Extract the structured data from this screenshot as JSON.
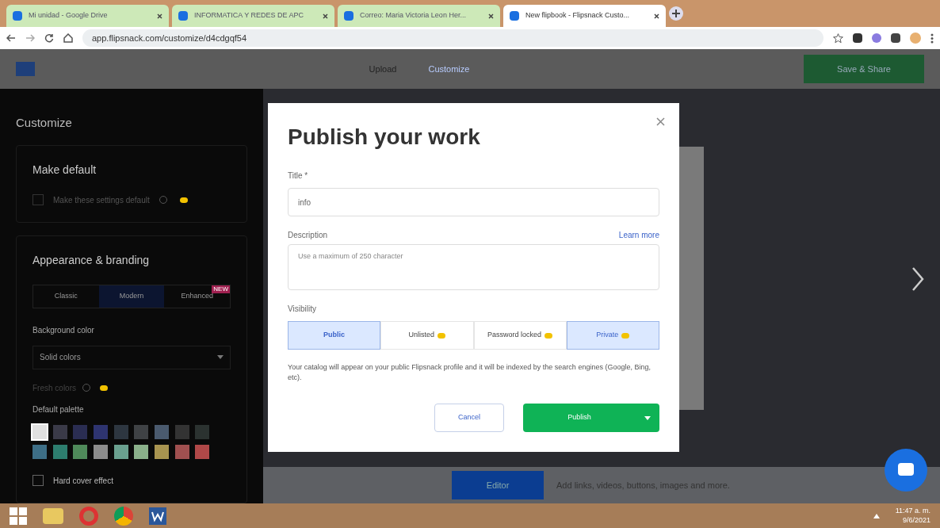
{
  "browser": {
    "tabs": [
      {
        "title": "Mi unidad - Google Drive",
        "selected": false
      },
      {
        "title": "INFORMATICA Y REDES DE APC",
        "selected": false
      },
      {
        "title": "Correo: Maria Victoria Leon Her...",
        "selected": false
      },
      {
        "title": "New flipbook - Flipsnack Custo...",
        "selected": true
      }
    ],
    "url": "app.flipsnack.com/customize/d4cdgqf54"
  },
  "header": {
    "nav": [
      {
        "label": "Upload",
        "selected": false
      },
      {
        "label": "Customize",
        "selected": true
      }
    ],
    "save_button": "Save & Share"
  },
  "sidebar": {
    "title": "Customize",
    "make_default": {
      "heading": "Make default",
      "option": "Make these settings default",
      "checked": false
    },
    "appearance": {
      "heading": "Appearance & branding",
      "styles": [
        {
          "label": "Classic",
          "selected": false
        },
        {
          "label": "Modern",
          "selected": true
        },
        {
          "label": "Enhanced",
          "selected": false,
          "badge": "NEW"
        }
      ],
      "background_label": "Background color",
      "background_value": "Solid colors",
      "fresh_colors": "Fresh colors",
      "palette_label": "Default palette",
      "palette": [
        {
          "color": "#e0e0e0",
          "selected": true
        },
        {
          "color": "#3a3a48",
          "selected": false
        },
        {
          "color": "#2a2d52",
          "selected": false
        },
        {
          "color": "#2e3470",
          "selected": false
        },
        {
          "color": "#2d3640",
          "selected": false
        },
        {
          "color": "#3f4245",
          "selected": false
        },
        {
          "color": "#4a5a6e",
          "selected": false
        },
        {
          "color": "#333333",
          "selected": false
        },
        {
          "color": "#2b3230",
          "selected": false
        },
        {
          "color": "#3d6e86",
          "selected": false
        },
        {
          "color": "#2d7d6e",
          "selected": false
        },
        {
          "color": "#4f8a5a",
          "selected": false
        },
        {
          "color": "#8c8c8c",
          "selected": false
        },
        {
          "color": "#6aa08f",
          "selected": false
        },
        {
          "color": "#8ab08a",
          "selected": false
        },
        {
          "color": "#a89450",
          "selected": false
        },
        {
          "color": "#a05050",
          "selected": false
        },
        {
          "color": "#b04848",
          "selected": false
        }
      ],
      "hard_cover": {
        "label": "Hard cover effect",
        "checked": false
      }
    }
  },
  "dialog": {
    "title": "Publish your work",
    "title_label": "Title *",
    "title_value": "info",
    "description_label": "Description",
    "learn_more": "Learn more",
    "description_placeholder": "Use a maximum of 250 character",
    "visibility_label": "Visibility",
    "visibility": [
      {
        "label": "Public",
        "selected": true,
        "premium": false,
        "hovered": false
      },
      {
        "label": "Unlisted",
        "selected": false,
        "premium": true,
        "hovered": false
      },
      {
        "label": "Password locked",
        "selected": false,
        "premium": true,
        "hovered": false
      },
      {
        "label": "Private",
        "selected": false,
        "premium": true,
        "hovered": true
      }
    ],
    "note": "Your catalog will appear on your public Flipsnack profile and it will be indexed by the search engines (Google, Bing, etc).",
    "cancel": "Cancel",
    "publish": "Publish"
  },
  "bottom_bar": {
    "editor_button": "Editor",
    "hint": "Add links, videos, buttons, images and more."
  },
  "taskbar": {
    "time": "11:47 a. m.",
    "date": "9/6/2021"
  }
}
